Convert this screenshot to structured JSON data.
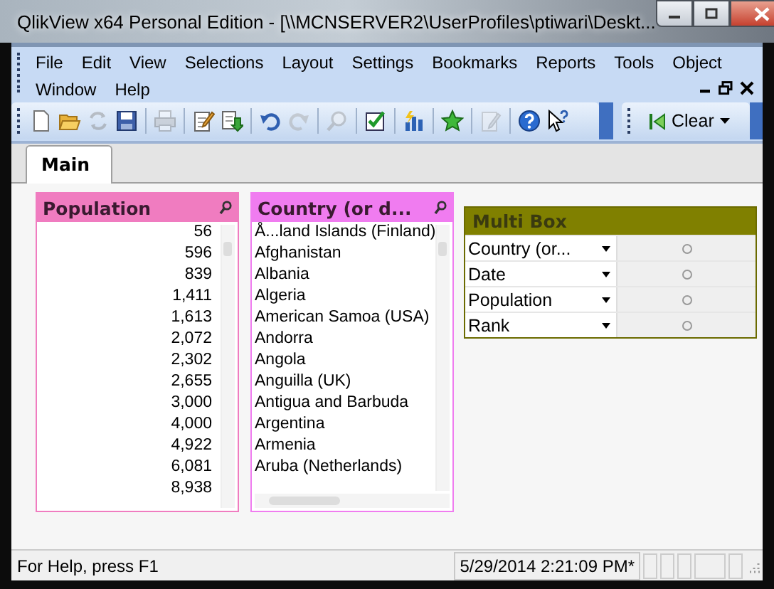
{
  "window": {
    "title": "QlikView x64 Personal Edition - [\\\\MCNSERVER2\\UserProfiles\\ptiwari\\Deskt..."
  },
  "menu": {
    "items": [
      "File",
      "Edit",
      "View",
      "Selections",
      "Layout",
      "Settings",
      "Bookmarks",
      "Reports",
      "Tools",
      "Object",
      "Window",
      "Help"
    ]
  },
  "toolbar": {
    "groups": [
      [
        {
          "kind": "new",
          "disabled": false
        },
        {
          "kind": "open",
          "disabled": false
        },
        {
          "kind": "reload",
          "disabled": true
        },
        {
          "kind": "save",
          "disabled": false
        }
      ],
      [
        {
          "kind": "print",
          "disabled": true
        }
      ],
      [
        {
          "kind": "edit",
          "disabled": false
        },
        {
          "kind": "export",
          "disabled": false
        }
      ],
      [
        {
          "kind": "undo",
          "disabled": false
        },
        {
          "kind": "redo",
          "disabled": true
        }
      ],
      [
        {
          "kind": "search",
          "disabled": true
        }
      ],
      [
        {
          "kind": "check",
          "disabled": false
        }
      ],
      [
        {
          "kind": "chart",
          "disabled": false
        }
      ],
      [
        {
          "kind": "star",
          "disabled": false
        }
      ],
      [
        {
          "kind": "pencil",
          "disabled": true
        }
      ],
      [
        {
          "kind": "help",
          "disabled": false
        },
        {
          "kind": "pointer",
          "disabled": false
        }
      ]
    ],
    "clear_button": {
      "label": "Clear"
    }
  },
  "tabs": [
    {
      "label": "Main",
      "selected": true
    }
  ],
  "listboxes": [
    {
      "title": "Population",
      "kind": "number",
      "color": "#f07cc0",
      "items": [
        "56",
        "596",
        "839",
        "1,411",
        "1,613",
        "2,072",
        "2,302",
        "2,655",
        "3,000",
        "4,000",
        "4,922",
        "6,081",
        "8,938"
      ]
    },
    {
      "title": "Country (or d...",
      "kind": "text",
      "color": "#f07cf0",
      "items": [
        "Å...land Islands (Finland)",
        "Afghanistan",
        "Albania",
        "Algeria",
        "American Samoa (USA)",
        "Andorra",
        "Angola",
        "Anguilla (UK)",
        "Antigua and Barbuda",
        "Argentina",
        "Armenia",
        "Aruba (Netherlands)"
      ]
    }
  ],
  "multi_box": {
    "title": "Multi Box",
    "fields": [
      "Country (or...",
      "Date",
      "Population",
      "Rank"
    ]
  },
  "status_bar": {
    "help": "For Help, press F1",
    "timestamp": "5/29/2014 2:21:09 PM*"
  }
}
